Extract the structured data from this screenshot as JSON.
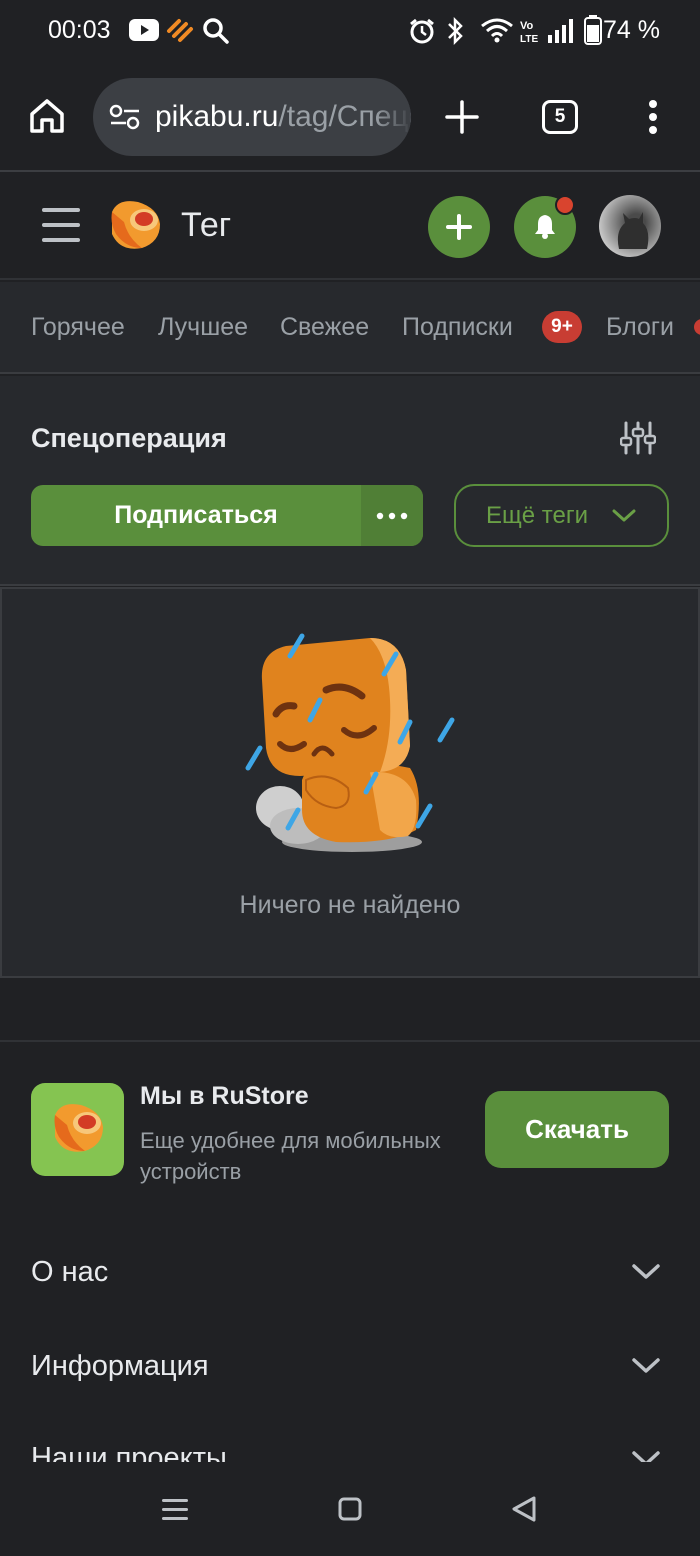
{
  "status_bar": {
    "time": "00:03",
    "battery_percent": "74 %",
    "icons": [
      "youtube-icon",
      "pikabu-notification-icon",
      "search-icon",
      "alarm-icon",
      "bluetooth-icon",
      "wifi-icon",
      "volte-icon",
      "signal-icon",
      "battery-icon"
    ]
  },
  "browser": {
    "url_host": "pikabu.ru",
    "url_path": "/tag/Спецоперация",
    "tab_count": "5",
    "icons": [
      "home-icon",
      "site-settings-icon",
      "new-tab-icon",
      "tab-switcher-icon",
      "overflow-menu-icon"
    ]
  },
  "header": {
    "title": "Тег",
    "icons": [
      "hamburger-menu-icon",
      "pikabu-logo",
      "add-post-icon",
      "notifications-bell-icon",
      "user-avatar"
    ]
  },
  "nav": {
    "items": [
      {
        "label": "Горячее"
      },
      {
        "label": "Лучшее"
      },
      {
        "label": "Свежее"
      },
      {
        "label": "Подписки",
        "badge": "9+"
      },
      {
        "label": "Блоги"
      }
    ]
  },
  "tag": {
    "name": "Спецоперация",
    "subscribe_label": "Подписаться",
    "more_tags_label": "Ещё теги"
  },
  "empty_state": {
    "message": "Ничего не найдено"
  },
  "footer": {
    "rustore_title": "Мы в RuStore",
    "rustore_subtitle": "Еще удобнее для мобильных устройств",
    "download_label": "Скачать",
    "sections": [
      {
        "label": "О нас"
      },
      {
        "label": "Информация"
      },
      {
        "label": "Наши проекты"
      }
    ]
  },
  "colors": {
    "background": "#202124",
    "panel": "#27292d",
    "accent_green": "#5a8f3c",
    "badge_red": "#c83d33",
    "mascot_orange": "#e0831e"
  }
}
